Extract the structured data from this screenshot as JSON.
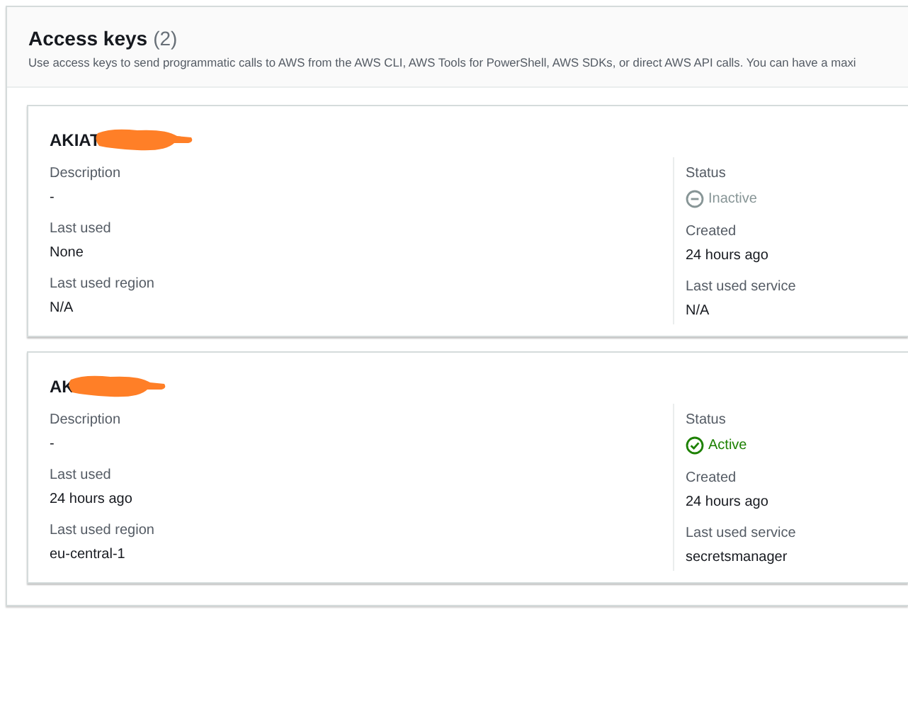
{
  "panel": {
    "title": "Access keys",
    "count": "(2)",
    "description": "Use access keys to send programmatic calls to AWS from the AWS CLI, AWS Tools for PowerShell, AWS SDKs, or direct AWS API calls. You can have a maxi"
  },
  "keys": [
    {
      "key_id": "AKIAT",
      "redacted": true,
      "left": [
        {
          "label": "Description",
          "value": "-"
        },
        {
          "label": "Last used",
          "value": "None"
        },
        {
          "label": "Last used region",
          "value": "N/A"
        }
      ],
      "status_label": "Status",
      "status": {
        "text": "Inactive",
        "active": false
      },
      "right": [
        {
          "label": "Created",
          "value": "24 hours ago"
        },
        {
          "label": "Last used service",
          "value": "N/A"
        }
      ]
    },
    {
      "key_id": "AK",
      "redacted": true,
      "left": [
        {
          "label": "Description",
          "value": "-"
        },
        {
          "label": "Last used",
          "value": "24 hours ago"
        },
        {
          "label": "Last used region",
          "value": "eu-central-1"
        }
      ],
      "status_label": "Status",
      "status": {
        "text": "Active",
        "active": true
      },
      "right": [
        {
          "label": "Created",
          "value": "24 hours ago"
        },
        {
          "label": "Last used service",
          "value": "secretsmanager"
        }
      ]
    }
  ]
}
